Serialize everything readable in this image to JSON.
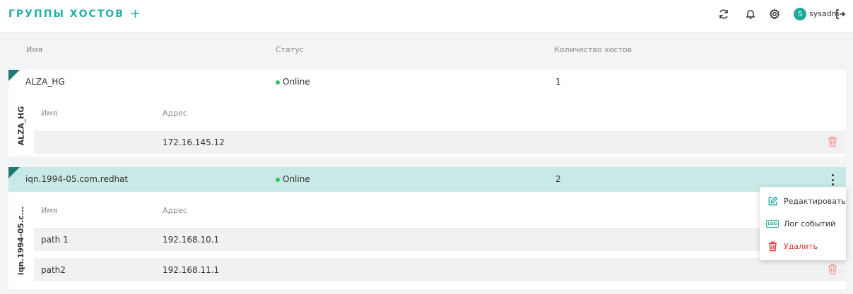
{
  "header": {
    "title": "ГРУППЫ ХОСТОВ",
    "add_label": "+",
    "user_initial": "S",
    "user_name": "sysadm",
    "icons": [
      "refresh-icon",
      "bell-icon",
      "gear-icon",
      "logout-icon"
    ]
  },
  "table": {
    "columns": [
      "Имя",
      "Статус",
      "Количество хостов"
    ]
  },
  "groups": [
    {
      "name": "ALZA_HG",
      "status": "Online",
      "host_count": "1",
      "vertical_label": "ALZA_HG",
      "sub_columns": [
        "Имя",
        "Адрес"
      ],
      "hosts": [
        {
          "name": "",
          "address": "172.16.145.12"
        }
      ]
    },
    {
      "name": "iqn.1994-05.com.redhat",
      "status": "Online",
      "host_count": "2",
      "vertical_label": "iqn.1994-05.c...",
      "sub_columns": [
        "Имя",
        "Адрес"
      ],
      "hosts": [
        {
          "name": "path 1",
          "address": "192.168.10.1"
        },
        {
          "name": "path2",
          "address": "192.168.11.1"
        }
      ]
    }
  ],
  "context_menu": {
    "edit": "Редактировать",
    "log": "Лог событий",
    "log_badge": "LOG",
    "delete": "Удалить"
  },
  "colors": {
    "accent": "#24b0a5",
    "selected_row": "#c8e9e6",
    "online": "#2cc55a",
    "danger": "#e23b3b"
  }
}
